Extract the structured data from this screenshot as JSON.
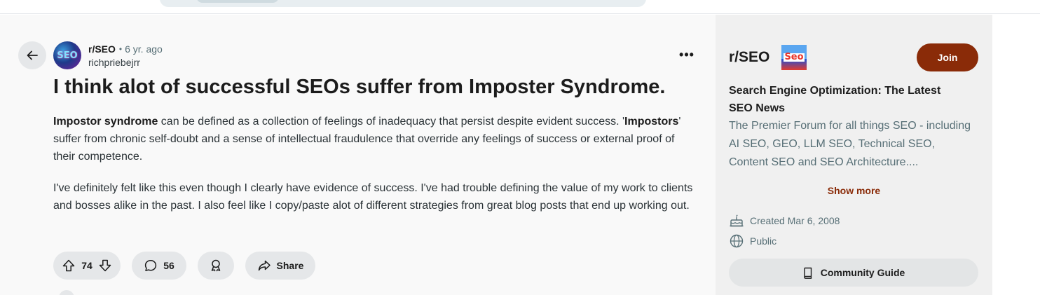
{
  "post": {
    "subreddit": "r/SEO",
    "age": "6 yr. ago",
    "author": "richpriebejrr",
    "avatar_text": "SEO",
    "title": "I think alot of successful SEOs suffer from Imposter Syndrome.",
    "body": {
      "p1_bold1": "Impostor syndrome",
      "p1_text1": " can be defined as a collection of feelings of inadequacy that persist despite evident success. '",
      "p1_bold2": "Impostors",
      "p1_text2": "' suffer from chronic self-doubt and a sense of intellectual fraudulence that override any feelings of success or external proof of their competence.",
      "p2": "I've definitely felt like this even though I clearly have evidence of success. I've had trouble defining the value of my work to clients and bosses alike in the past. I also feel like I copy/paste alot of different strategies from great blog posts that end up working out."
    },
    "votes": "74",
    "comments": "56",
    "share_label": "Share",
    "more_label": "•••"
  },
  "sidebar": {
    "title": "r/SEO",
    "icon_text": "Seo",
    "join_label": "Join",
    "headline": "Search Engine Optimization: The Latest SEO News",
    "description": "The Premier Forum for all things SEO - including AI SEO, GEO, LLM SEO, Technical SEO, Content SEO and SEO Architecture....",
    "show_more_label": "Show more",
    "created": "Created Mar 6, 2008",
    "visibility": "Public",
    "guide_label": "Community Guide"
  },
  "colors": {
    "accent": "#8a2b08",
    "pill_bg": "#e5e7e9",
    "muted_text": "#576f76"
  },
  "icons": [
    "back-arrow-icon",
    "more-options-icon",
    "upvote-icon",
    "downvote-icon",
    "comment-icon",
    "award-icon",
    "share-icon",
    "cake-icon",
    "globe-icon",
    "book-icon"
  ]
}
